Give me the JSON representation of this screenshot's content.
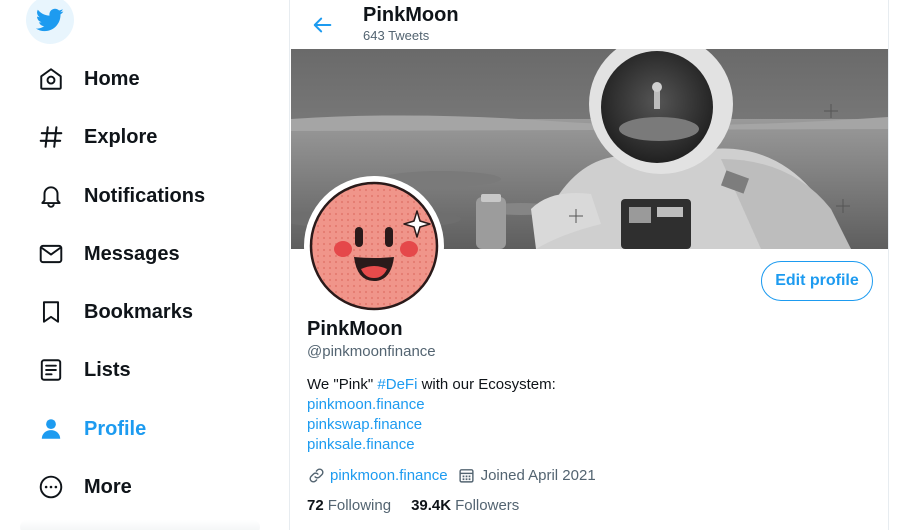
{
  "sidebar": {
    "logo_icon": "twitter-bird-icon",
    "items": [
      {
        "label": "Home",
        "icon": "home-icon"
      },
      {
        "label": "Explore",
        "icon": "hashtag-icon"
      },
      {
        "label": "Notifications",
        "icon": "bell-icon"
      },
      {
        "label": "Messages",
        "icon": "mail-icon"
      },
      {
        "label": "Bookmarks",
        "icon": "bookmark-icon"
      },
      {
        "label": "Lists",
        "icon": "list-icon"
      },
      {
        "label": "Profile",
        "icon": "person-icon",
        "active": true
      },
      {
        "label": "More",
        "icon": "more-circle-icon"
      }
    ]
  },
  "header": {
    "title": "PinkMoon",
    "subtitle": "643 Tweets",
    "back_icon": "arrow-left-icon"
  },
  "profile": {
    "name": "PinkMoon",
    "handle": "@pinkmoonfinance",
    "edit_label": "Edit profile",
    "bio": {
      "pre": "We \"Pink\" ",
      "hashtag": "#DeFi",
      "post": " with our Ecosystem:",
      "links": [
        "pinkmoon.finance",
        "pinkswap.finance",
        "pinksale.finance"
      ]
    },
    "website": "pinkmoon.finance",
    "joined": "Joined April 2021",
    "following_count": "72",
    "following_label": "Following",
    "followers_count": "39.4K",
    "followers_label": "Followers"
  },
  "colors": {
    "accent": "#1d9bf0",
    "text": "#0f1419",
    "muted": "#536471",
    "avatar_bg": "#f0958a"
  }
}
